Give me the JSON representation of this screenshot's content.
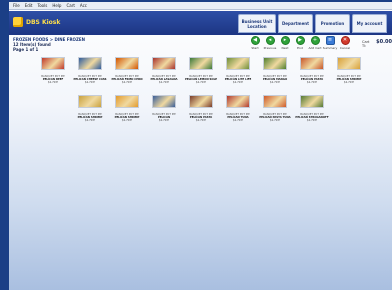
{
  "menu": [
    "File",
    "Edit",
    "Tools",
    "Help",
    "Cart",
    "Acc"
  ],
  "app": {
    "title": "DBS Kiosk",
    "accent": "#1c3583",
    "brand_color": "#ffe04a"
  },
  "nav": [
    {
      "label": "Business Unit Location",
      "wide": true
    },
    {
      "label": "Department"
    },
    {
      "label": "Promotion"
    },
    {
      "label": "My account"
    }
  ],
  "breadcrumb": "FROZEN FOODS > DINE FROZEN",
  "items_found": "12 Item(s) found",
  "page": "Page 1 of 1",
  "toolbar": [
    {
      "label": "Start",
      "glyph": "◀",
      "color": "green",
      "icon": "back-icon"
    },
    {
      "label": "Previous",
      "glyph": "◂",
      "color": "green",
      "icon": "previous-icon"
    },
    {
      "label": "Next",
      "glyph": "▸",
      "color": "green",
      "icon": "next-icon"
    },
    {
      "label": "End",
      "glyph": "▶",
      "color": "green",
      "icon": "end-icon"
    },
    {
      "label": "Add Cart",
      "glyph": "+",
      "color": "green",
      "icon": "add-cart-icon"
    },
    {
      "label": "Summary",
      "glyph": "≡",
      "color": "blue",
      "icon": "summary-icon"
    },
    {
      "label": "Cancel",
      "glyph": "✕",
      "color": "red",
      "icon": "cancel-icon"
    }
  ],
  "total": {
    "label": "Cart Tl:",
    "value": "$0.00"
  },
  "products": [
    {
      "brand": "BANQUET POT PIE",
      "name": "PELICAN BEEF",
      "price": "$1.79 E",
      "color": "#c0392b"
    },
    {
      "brand": "BANQUET POT PIE",
      "name": "PELICAN CHEESE CASS",
      "price": "$1.79 E",
      "color": "#2e5c9e"
    },
    {
      "brand": "BANQUET POT PIE",
      "name": "PELICAN FRIED CHKN",
      "price": "$1.79 E",
      "color": "#d35400"
    },
    {
      "brand": "BANQUET POT PIE",
      "name": "PELICAN LASAGNA",
      "price": "$1.79 E",
      "color": "#a8322e"
    },
    {
      "brand": "BANQUET POT PIE",
      "name": "PELICAN LEMON SOLE",
      "price": "$1.79 E",
      "color": "#3d7a3a"
    },
    {
      "brand": "BANQUET POT PIE",
      "name": "PELICAN LITE LIFE",
      "price": "$1.79 E",
      "color": "#6f8f3a"
    },
    {
      "brand": "BANQUET POT PIE",
      "name": "PELICAN MANGO",
      "price": "$1.79 E",
      "color": "#4f7f2f"
    },
    {
      "brand": "BANQUET POT PIE",
      "name": "PELICAN PASTA",
      "price": "$1.79 E",
      "color": "#c8572b"
    },
    {
      "brand": "BANQUET POT PIE",
      "name": "PELICAN SHRIMP",
      "price": "$1.79 E",
      "color": "#d8a23a"
    },
    {
      "brand": "BANQUET POT PIE",
      "name": "PELICAN SHRIMP",
      "price": "$1.79 E",
      "color": "#c9a23f"
    },
    {
      "brand": "BANQUET POT PIE",
      "name": "PELICAN SHRIMP",
      "price": "$1.79 E",
      "color": "#e39b2d"
    },
    {
      "brand": "BANQUET POT PIE",
      "name": "PELICAN",
      "price": "$1.79 E",
      "color": "#3b5f9a"
    },
    {
      "brand": "BANQUET POT PIE",
      "name": "PELICAN PASTA",
      "price": "$1.79 E",
      "color": "#7a3d2a"
    },
    {
      "brand": "BANQUET POT PIE",
      "name": "PELICAN TUNA",
      "price": "$1.79 E",
      "color": "#b23a30"
    },
    {
      "brand": "BANQUET POT PIE",
      "name": "PELICAN PASTA TUNA",
      "price": "$1.79 E",
      "color": "#cf5a2a"
    },
    {
      "brand": "BANQUET POT PIE",
      "name": "PELICAN STROGANOFF",
      "price": "$1.79 E",
      "color": "#557a35"
    }
  ]
}
